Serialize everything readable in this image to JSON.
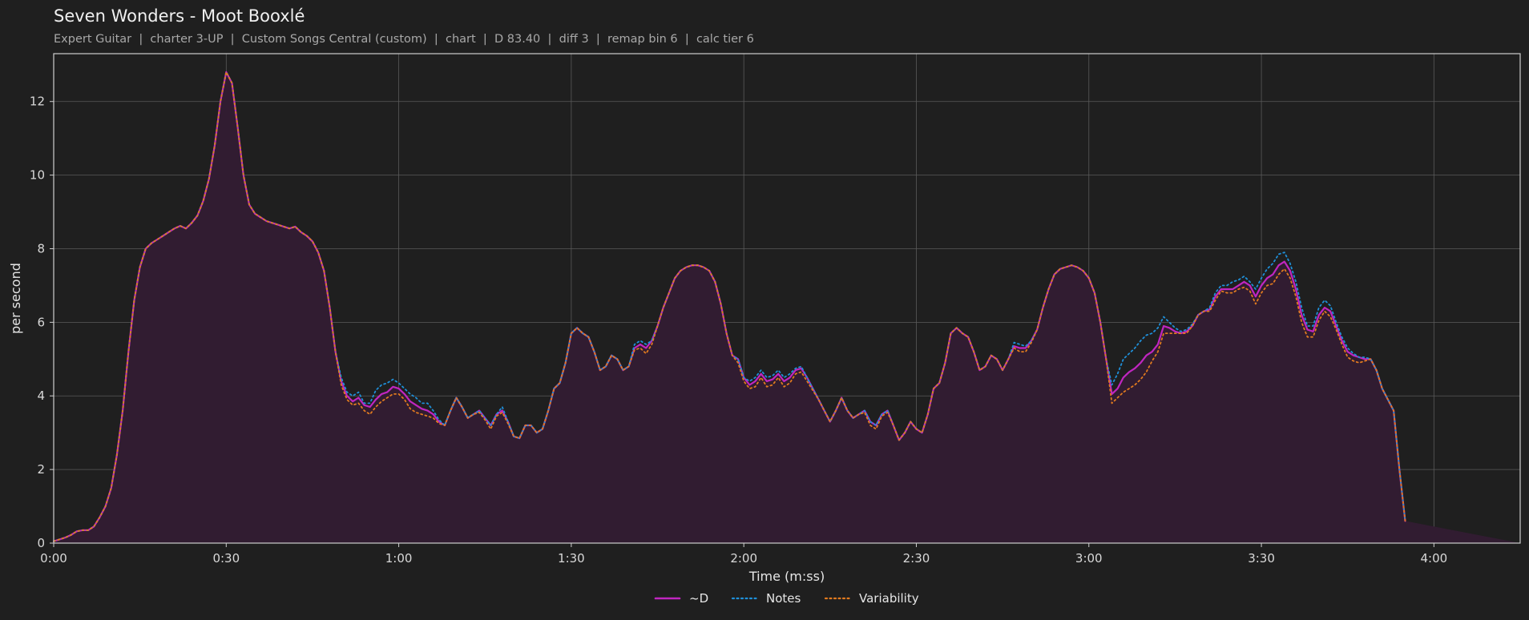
{
  "header": {
    "title": "Seven Wonders - Moot Booxlé",
    "subtitle": "Expert Guitar  |  charter 3-UP  |  Custom Songs Central (custom)  |  chart  |  D 83.40  |  diff 3  |  remap bin 6  |  calc tier 6"
  },
  "colors": {
    "background": "#1f1f1f",
    "grid": "#5a5a5a",
    "fill": "#311c31",
    "d_line": "#c026c0",
    "notes_line": "#1f8fd8",
    "variability_line": "#e07a1f"
  },
  "chart_data": {
    "type": "line",
    "title": "Seven Wonders - Moot Booxlé",
    "xlabel": "Time (m:ss)",
    "ylabel": "per second",
    "xlim": [
      0,
      255
    ],
    "ylim": [
      0,
      13.3
    ],
    "grid": true,
    "legend_position": "bottom-center",
    "x_ticks": [
      0,
      30,
      60,
      90,
      120,
      150,
      180,
      210,
      240
    ],
    "x_tick_labels": [
      "0:00",
      "0:30",
      "1:00",
      "1:30",
      "2:00",
      "2:30",
      "3:00",
      "3:30",
      "4:00"
    ],
    "y_ticks": [
      0,
      2,
      4,
      6,
      8,
      10,
      12
    ],
    "y_tick_labels": [
      "0",
      "2",
      "4",
      "6",
      "8",
      "10",
      "12"
    ],
    "x": [
      0,
      1,
      2,
      3,
      4,
      5,
      6,
      7,
      8,
      9,
      10,
      11,
      12,
      13,
      14,
      15,
      16,
      17,
      18,
      19,
      20,
      21,
      22,
      23,
      24,
      25,
      26,
      27,
      28,
      29,
      30,
      31,
      32,
      33,
      34,
      35,
      36,
      37,
      38,
      39,
      40,
      41,
      42,
      43,
      44,
      45,
      46,
      47,
      48,
      49,
      50,
      51,
      52,
      53,
      54,
      55,
      56,
      57,
      58,
      59,
      60,
      61,
      62,
      63,
      64,
      65,
      66,
      67,
      68,
      69,
      70,
      71,
      72,
      73,
      74,
      75,
      76,
      77,
      78,
      79,
      80,
      81,
      82,
      83,
      84,
      85,
      86,
      87,
      88,
      89,
      90,
      91,
      92,
      93,
      94,
      95,
      96,
      97,
      98,
      99,
      100,
      101,
      102,
      103,
      104,
      105,
      106,
      107,
      108,
      109,
      110,
      111,
      112,
      113,
      114,
      115,
      116,
      117,
      118,
      119,
      120,
      121,
      122,
      123,
      124,
      125,
      126,
      127,
      128,
      129,
      130,
      131,
      132,
      133,
      134,
      135,
      136,
      137,
      138,
      139,
      140,
      141,
      142,
      143,
      144,
      145,
      146,
      147,
      148,
      149,
      150,
      151,
      152,
      153,
      154,
      155,
      156,
      157,
      158,
      159,
      160,
      161,
      162,
      163,
      164,
      165,
      166,
      167,
      168,
      169,
      170,
      171,
      172,
      173,
      174,
      175,
      176,
      177,
      178,
      179,
      180,
      181,
      182,
      183,
      184,
      185,
      186,
      187,
      188,
      189,
      190,
      191,
      192,
      193,
      194,
      195,
      196,
      197,
      198,
      199,
      200,
      201,
      202,
      203,
      204,
      205,
      206,
      207,
      208,
      209,
      210,
      211,
      212,
      213,
      214,
      215,
      216,
      217,
      218,
      219,
      220,
      221,
      222,
      223,
      224,
      225,
      226,
      227,
      228,
      229,
      230,
      231,
      232,
      233,
      234,
      235,
      236,
      237,
      238,
      239,
      240,
      241,
      242,
      243,
      244,
      245,
      246,
      247,
      248,
      249,
      250,
      251,
      252,
      253,
      254,
      255
    ],
    "series": [
      {
        "name": "~D",
        "style": "solid",
        "values": [
          0.05,
          0.1,
          0.15,
          0.22,
          0.32,
          0.35,
          0.35,
          0.45,
          0.7,
          1.0,
          1.5,
          2.4,
          3.6,
          5.2,
          6.6,
          7.5,
          8.0,
          8.15,
          8.25,
          8.35,
          8.45,
          8.55,
          8.62,
          8.55,
          8.7,
          8.9,
          9.3,
          9.9,
          10.8,
          12.0,
          12.8,
          12.5,
          11.3,
          10.0,
          9.2,
          8.95,
          8.85,
          8.75,
          8.7,
          8.65,
          8.6,
          8.55,
          8.6,
          8.45,
          8.35,
          8.2,
          7.9,
          7.4,
          6.4,
          5.2,
          4.4,
          4.0,
          3.85,
          3.95,
          3.75,
          3.7,
          3.9,
          4.05,
          4.1,
          4.25,
          4.2,
          4.05,
          3.85,
          3.75,
          3.65,
          3.6,
          3.5,
          3.3,
          3.2,
          3.6,
          3.95,
          3.7,
          3.4,
          3.5,
          3.6,
          3.4,
          3.2,
          3.5,
          3.6,
          3.3,
          2.9,
          2.85,
          3.2,
          3.2,
          3.0,
          3.1,
          3.6,
          4.2,
          4.35,
          4.9,
          5.7,
          5.85,
          5.7,
          5.6,
          5.2,
          4.7,
          4.8,
          5.1,
          5.0,
          4.7,
          4.8,
          5.3,
          5.4,
          5.3,
          5.5,
          5.9,
          6.4,
          6.8,
          7.2,
          7.4,
          7.5,
          7.55,
          7.55,
          7.5,
          7.4,
          7.1,
          6.5,
          5.7,
          5.1,
          5.0,
          4.5,
          4.3,
          4.4,
          4.6,
          4.4,
          4.45,
          4.6,
          4.4,
          4.5,
          4.7,
          4.75,
          4.5,
          4.2,
          3.9,
          3.6,
          3.3,
          3.6,
          3.95,
          3.6,
          3.4,
          3.5,
          3.6,
          3.3,
          3.2,
          3.5,
          3.6,
          3.2,
          2.8,
          3.0,
          3.3,
          3.1,
          3.0,
          3.5,
          4.2,
          4.35,
          4.9,
          5.7,
          5.85,
          5.7,
          5.6,
          5.2,
          4.7,
          4.8,
          5.1,
          5.0,
          4.7,
          5.0,
          5.35,
          5.3,
          5.3,
          5.5,
          5.8,
          6.4,
          6.9,
          7.3,
          7.45,
          7.5,
          7.55,
          7.5,
          7.4,
          7.2,
          6.8,
          6.0,
          5.0,
          4.05,
          4.2,
          4.5,
          4.65,
          4.75,
          4.9,
          5.1,
          5.2,
          5.4,
          5.9,
          5.85,
          5.75,
          5.7,
          5.75,
          5.9,
          6.2,
          6.3,
          6.35,
          6.7,
          6.9,
          6.9,
          6.9,
          7.0,
          7.1,
          7.0,
          6.7,
          7.0,
          7.2,
          7.3,
          7.55,
          7.65,
          7.4,
          6.9,
          6.2,
          5.8,
          5.75,
          6.2,
          6.4,
          6.3,
          5.9,
          5.5,
          5.2,
          5.1,
          5.05,
          5.0,
          5.0,
          4.7,
          4.2,
          3.9,
          3.6,
          2.0,
          0.6
        ]
      },
      {
        "name": "Notes",
        "style": "dotted",
        "values": [
          0.05,
          0.1,
          0.15,
          0.22,
          0.32,
          0.35,
          0.35,
          0.45,
          0.7,
          1.0,
          1.5,
          2.4,
          3.6,
          5.2,
          6.6,
          7.5,
          8.0,
          8.15,
          8.25,
          8.35,
          8.45,
          8.55,
          8.62,
          8.55,
          8.7,
          8.9,
          9.3,
          9.9,
          10.8,
          12.0,
          12.8,
          12.5,
          11.3,
          10.0,
          9.2,
          8.95,
          8.85,
          8.75,
          8.7,
          8.65,
          8.6,
          8.55,
          8.6,
          8.45,
          8.35,
          8.2,
          7.9,
          7.4,
          6.4,
          5.2,
          4.5,
          4.1,
          4.0,
          4.1,
          3.8,
          3.8,
          4.15,
          4.3,
          4.35,
          4.45,
          4.35,
          4.2,
          4.05,
          3.95,
          3.8,
          3.8,
          3.6,
          3.35,
          3.2,
          3.6,
          3.95,
          3.7,
          3.4,
          3.5,
          3.6,
          3.4,
          3.2,
          3.5,
          3.7,
          3.3,
          2.9,
          2.85,
          3.2,
          3.2,
          3.0,
          3.1,
          3.6,
          4.2,
          4.35,
          4.9,
          5.7,
          5.85,
          5.7,
          5.6,
          5.2,
          4.7,
          4.8,
          5.1,
          5.0,
          4.7,
          4.8,
          5.4,
          5.5,
          5.4,
          5.5,
          5.9,
          6.4,
          6.8,
          7.2,
          7.4,
          7.5,
          7.55,
          7.55,
          7.5,
          7.4,
          7.1,
          6.5,
          5.7,
          5.1,
          5.0,
          4.5,
          4.4,
          4.5,
          4.7,
          4.5,
          4.55,
          4.7,
          4.5,
          4.6,
          4.75,
          4.8,
          4.5,
          4.2,
          3.9,
          3.6,
          3.3,
          3.6,
          3.95,
          3.6,
          3.4,
          3.5,
          3.6,
          3.3,
          3.2,
          3.5,
          3.6,
          3.2,
          2.8,
          3.0,
          3.3,
          3.1,
          3.0,
          3.5,
          4.2,
          4.35,
          4.9,
          5.7,
          5.85,
          5.7,
          5.6,
          5.2,
          4.7,
          4.8,
          5.1,
          5.0,
          4.7,
          5.0,
          5.45,
          5.4,
          5.35,
          5.5,
          5.8,
          6.4,
          6.9,
          7.3,
          7.45,
          7.5,
          7.55,
          7.5,
          7.4,
          7.2,
          6.8,
          6.0,
          5.0,
          4.3,
          4.6,
          5.0,
          5.15,
          5.3,
          5.5,
          5.65,
          5.7,
          5.85,
          6.15,
          6.0,
          5.85,
          5.75,
          5.8,
          5.95,
          6.2,
          6.3,
          6.4,
          6.8,
          7.0,
          7.0,
          7.1,
          7.15,
          7.25,
          7.1,
          6.9,
          7.2,
          7.45,
          7.6,
          7.85,
          7.9,
          7.6,
          7.1,
          6.4,
          5.9,
          5.9,
          6.4,
          6.6,
          6.45,
          6.0,
          5.6,
          5.3,
          5.15,
          5.05,
          5.05,
          5.0,
          4.7,
          4.2,
          3.9,
          3.6,
          2.0,
          0.6
        ]
      },
      {
        "name": "Variability",
        "style": "dotted",
        "values": [
          0.05,
          0.1,
          0.15,
          0.22,
          0.32,
          0.35,
          0.35,
          0.45,
          0.7,
          1.0,
          1.5,
          2.4,
          3.6,
          5.2,
          6.6,
          7.5,
          8.0,
          8.15,
          8.25,
          8.35,
          8.45,
          8.55,
          8.62,
          8.55,
          8.7,
          8.9,
          9.3,
          9.9,
          10.8,
          12.0,
          12.8,
          12.5,
          11.3,
          10.0,
          9.2,
          8.95,
          8.85,
          8.75,
          8.7,
          8.65,
          8.6,
          8.55,
          8.6,
          8.45,
          8.35,
          8.2,
          7.9,
          7.4,
          6.4,
          5.2,
          4.3,
          3.9,
          3.75,
          3.8,
          3.6,
          3.5,
          3.7,
          3.85,
          3.95,
          4.05,
          4.05,
          3.9,
          3.65,
          3.55,
          3.5,
          3.45,
          3.4,
          3.25,
          3.2,
          3.6,
          3.95,
          3.7,
          3.4,
          3.5,
          3.55,
          3.35,
          3.1,
          3.45,
          3.55,
          3.25,
          2.9,
          2.85,
          3.2,
          3.2,
          3.0,
          3.1,
          3.6,
          4.2,
          4.35,
          4.9,
          5.7,
          5.85,
          5.7,
          5.6,
          5.2,
          4.7,
          4.8,
          5.1,
          5.0,
          4.7,
          4.8,
          5.25,
          5.3,
          5.15,
          5.4,
          5.9,
          6.4,
          6.8,
          7.2,
          7.4,
          7.5,
          7.55,
          7.55,
          7.5,
          7.4,
          7.1,
          6.5,
          5.7,
          5.1,
          4.9,
          4.4,
          4.2,
          4.25,
          4.5,
          4.25,
          4.3,
          4.5,
          4.25,
          4.35,
          4.6,
          4.65,
          4.4,
          4.15,
          3.9,
          3.6,
          3.3,
          3.6,
          3.95,
          3.6,
          3.4,
          3.5,
          3.55,
          3.2,
          3.1,
          3.45,
          3.55,
          3.2,
          2.8,
          3.0,
          3.3,
          3.1,
          3.0,
          3.5,
          4.2,
          4.35,
          4.9,
          5.7,
          5.85,
          5.7,
          5.6,
          5.2,
          4.7,
          4.8,
          5.1,
          5.0,
          4.7,
          5.0,
          5.3,
          5.2,
          5.2,
          5.45,
          5.8,
          6.4,
          6.9,
          7.3,
          7.45,
          7.5,
          7.55,
          7.5,
          7.4,
          7.2,
          6.8,
          6.0,
          5.0,
          3.8,
          3.95,
          4.1,
          4.2,
          4.3,
          4.45,
          4.65,
          4.95,
          5.2,
          5.7,
          5.7,
          5.7,
          5.7,
          5.7,
          5.9,
          6.2,
          6.3,
          6.3,
          6.6,
          6.85,
          6.8,
          6.8,
          6.9,
          6.95,
          6.85,
          6.5,
          6.8,
          7.0,
          7.05,
          7.3,
          7.45,
          7.2,
          6.7,
          6.0,
          5.6,
          5.6,
          6.05,
          6.3,
          6.15,
          5.8,
          5.4,
          5.05,
          4.95,
          4.9,
          4.95,
          5.0,
          4.7,
          4.2,
          3.9,
          3.6,
          2.0,
          0.6
        ]
      }
    ]
  }
}
